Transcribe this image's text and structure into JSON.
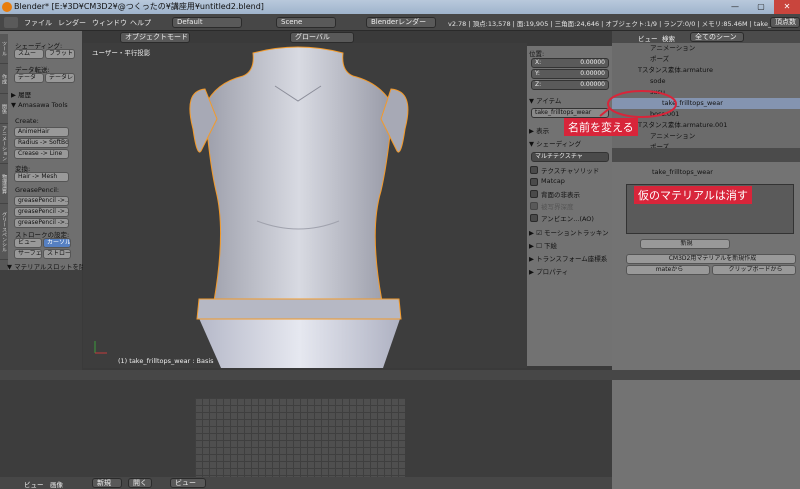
{
  "titlebar": {
    "text": "Blender* [E:¥3D¥CM3D2¥@つくったの¥講座用¥untitled2.blend]",
    "min": "—",
    "max": "▢",
    "close": "✕"
  },
  "menu": {
    "items": [
      "ファイル",
      "レンダー",
      "ウィンドウ",
      "ヘルプ"
    ],
    "layout": "Default",
    "scene": "Scene",
    "engine": "Blenderレンダー",
    "stats": "v2.78 | 頂点:13,578 | 面:19,905 | 三角面:24,646 | オブジェクト:1/9 | ランプ:0/0 | メモリ:85.46M | take_frilltops_wear",
    "right_btn": "頂点数"
  },
  "left_panel": {
    "tabs": [
      "ツール",
      "作成",
      "関係",
      "アニメーション",
      "物理演算",
      "グリースペンシル"
    ],
    "shading_label": "シェーディング:",
    "smooth": "スムー",
    "flat": "フラット",
    "data_transfer_label": "データ転送:",
    "data": "データ",
    "data_lay": "データレ",
    "history": "履歴",
    "amasawa": "Amasawa Tools",
    "create_label": "Create:",
    "btns": [
      "AnimeHair",
      "Radius -> SoftBo..",
      "Crease -> Line"
    ],
    "convert_label": "変換:",
    "hair_mesh": "Hair -> Mesh",
    "gp_label": "GreasePencil:",
    "gp_btns": [
      "greasePencil ->..",
      "greasePencil ->..",
      "greasePencil ->.."
    ],
    "stroke_label": "ストロークの設定:",
    "view": "ビュー",
    "cursor": "カーソル",
    "surface": "サーフェ",
    "stroke": "ストロー",
    "material_slot": "マテリアルスロットを除"
  },
  "viewport": {
    "label": "ユーザー・平行投影",
    "mode": "オブジェクトモード",
    "global": "グローバル",
    "status": "(1) take_frilltops_wear : Basis"
  },
  "props": {
    "pos_label": "位置:",
    "x": "X:",
    "x_val": "0.00000",
    "y": "Y:",
    "y_val": "0.00000",
    "z": "Z:",
    "z_val": "0.00000",
    "item": "アイテム",
    "item_name": "take_frilltops_wear",
    "display": "表示",
    "shading": "シェーディング",
    "multitex": "マルチテクスチャ",
    "checks": [
      "テクスチャソリッド",
      "Matcap",
      "背面の非表示",
      "被写界深度",
      "アンビエン...(AO)"
    ],
    "motion": "モーショントラッキン",
    "ground": "下絵",
    "transform": "トランスフォーム座標系",
    "property": "プロパティ"
  },
  "outliner": {
    "view": "ビュー",
    "search": "検索",
    "all_scenes": "全てのシーン",
    "rows": [
      "アニメーション",
      "ポーズ",
      "Tスタンス素体.armature",
      "sode",
      "susu",
      "take_frilltops_wear",
      "boss.001",
      "Tスタンス素体.armature.001",
      "アニメーション",
      "ポーズ"
    ]
  },
  "annotation": {
    "rename": "名前を変える",
    "delete_material": "仮のマテリアルは消す"
  },
  "material": {
    "object_name": "take_frilltops_wear",
    "new": "新規",
    "cm3d2_new": "CM3D2用マテリアルを新規作成",
    "from_mate": "mateから",
    "from_clip": "クリップボードから"
  },
  "bottom": {
    "view": "ビュー",
    "image": "画像",
    "new": "新規",
    "open": "開く",
    "view2": "ビュー"
  },
  "colors": {
    "annotation_red": "#d8253a",
    "select_blue": "#5680c2",
    "object_orange": "#f39a2a"
  }
}
